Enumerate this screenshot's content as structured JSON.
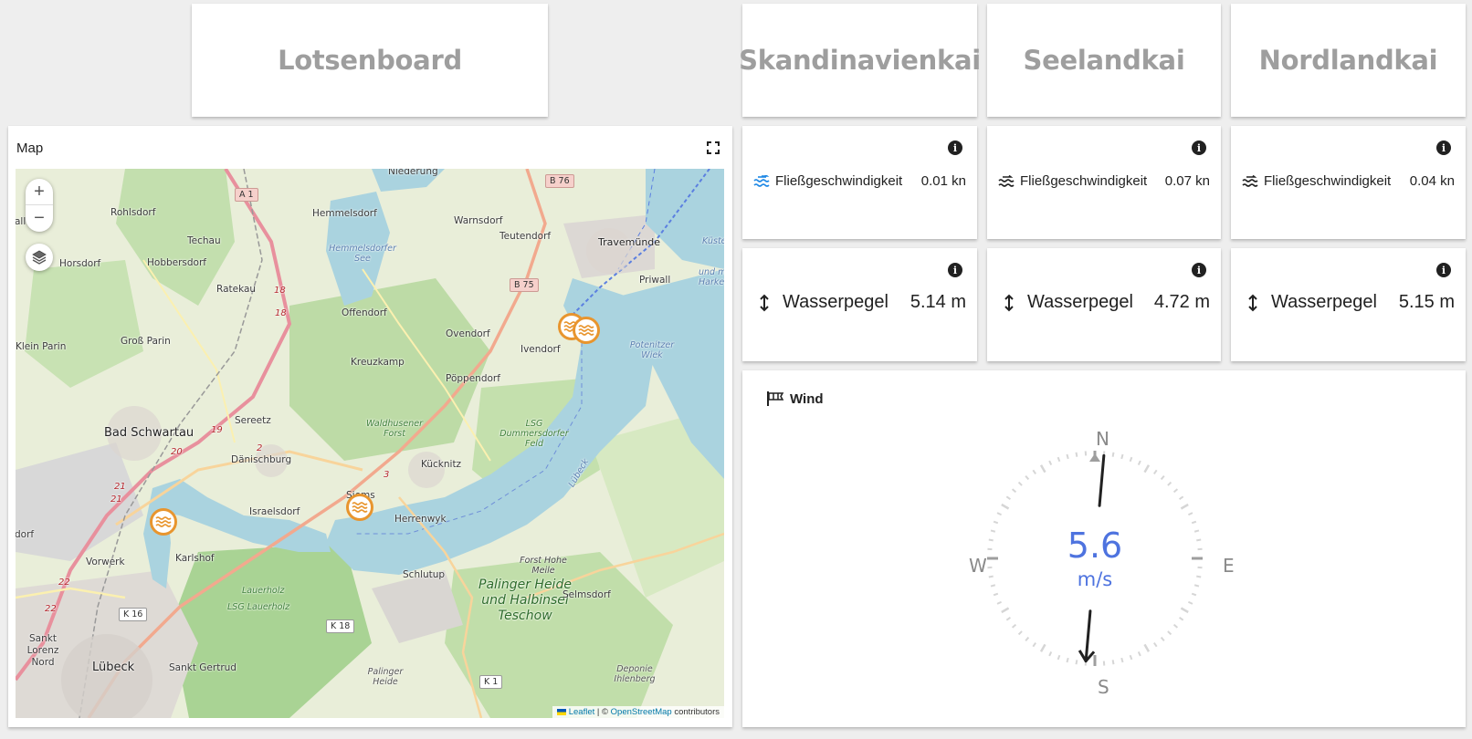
{
  "header": {
    "app_title": "Lotsenboard"
  },
  "stations": [
    {
      "name": "Skandinavienkai",
      "flow_label": "Fließgeschwindigkeit",
      "flow_value": "0.01 kn",
      "level_label": "Wasserpegel",
      "level_value": "5.14 m"
    },
    {
      "name": "Seelandkai",
      "flow_label": "Fließgeschwindigkeit",
      "flow_value": "0.07 kn",
      "level_label": "Wasserpegel",
      "level_value": "4.72 m"
    },
    {
      "name": "Nordlandkai",
      "flow_label": "Fließgeschwindigkeit",
      "flow_value": "0.04 kn",
      "level_label": "Wasserpegel",
      "level_value": "5.15 m"
    }
  ],
  "map": {
    "title": "Map",
    "zoom_in": "+",
    "zoom_out": "−",
    "attribution_leaflet": "Leaflet",
    "attribution_sep": " | © ",
    "attribution_osm": "OpenStreetMap",
    "attribution_tail": " contributors",
    "marker_icons": [
      "wave-marker-icon",
      "wave-marker-icon",
      "wave-marker-icon",
      "wave-marker-icon"
    ],
    "labels": {
      "niederung": "Niederung",
      "b76": "B 76",
      "a1": "A 1",
      "rohlsdorf": "Rohlsdorf",
      "hemmelsdorf": "Hemmelsdorf",
      "warnsdorf": "Warnsdorf",
      "teutendorf": "Teutendorf",
      "travemuende": "Travemünde",
      "kueste": "Küste",
      "techau": "Techau",
      "hemmelsdorfer_see": "Hemmelsdorfer See",
      "horsdorf": "Horsdorf",
      "hobbersdorf": "Hobbersdorf",
      "priwall": "Priwall",
      "und_mit_harke": "und mit Harke",
      "ratekau": "Ratekau",
      "r18a": "18",
      "b75": "B 75",
      "r18b": "18",
      "offendorf": "Offendorf",
      "ovendorf": "Ovendorf",
      "potenitzer_wiek": "Potenitzer Wiek",
      "klein_parin": "Klein Parin",
      "gross_parin": "Groß Parin",
      "ivendorf": "Ivendorf",
      "kreuzkamp": "Kreuzkamp",
      "poeppendorf": "Pöppendorf",
      "bad_schwartau": "Bad Schwartau",
      "sereetz": "Sereetz",
      "waldhusener_forst": "Waldhusener Forst",
      "lsg_dummersdorfer": "LSG Dummersdorfer Feld",
      "r19": "19",
      "r2": "2",
      "r20": "20",
      "daenischburg": "Dänischburg",
      "r3": "3",
      "kuecknitz": "Kücknitz",
      "r21a": "21",
      "r21b": "21",
      "israelsdorf": "Israelsdorf",
      "siems": "Siems",
      "herrenwyk": "Herrenwyk",
      "dorf": "dorf",
      "karlshof": "Karlshof",
      "vorwerk": "Vorwerk",
      "forst_hohe_meile": "Forst Hohe Meile",
      "schlutup": "Schlutup",
      "lauerholz": "Lauerholz",
      "lsg_lauerholz": "LSG Lauerholz",
      "palinger_heide": "Palinger Heide und Halbinsel Teschow",
      "selmsdorf": "Selmsdorf",
      "r22a": "22",
      "r22b": "22",
      "k16": "K 16",
      "k18": "K 18",
      "sankt_lorenz": "Sankt Lorenz Nord",
      "luebeck": "Lübeck",
      "sankt_gertrud": "Sankt Gertrud",
      "palinger_heide_small": "Palinger Heide",
      "k1": "K 1",
      "deponie": "Deponie Ihlenberg",
      "luebeck_river": "Lübeck",
      "all_dorf": "all dorf"
    }
  },
  "wind": {
    "title": "Wind",
    "speed": "5.6",
    "unit": "m/s",
    "north": "N",
    "east": "E",
    "south": "S",
    "west": "W",
    "direction_deg": 185,
    "colors": {
      "speed": "#4e73df",
      "ticks": "#d6d6d6",
      "needle": "#212121"
    }
  },
  "colors": {
    "background": "#eeeeee",
    "title_text": "#9e9e9e",
    "marker": "#e8952e",
    "flow_icon_active": "#1e88e5"
  }
}
